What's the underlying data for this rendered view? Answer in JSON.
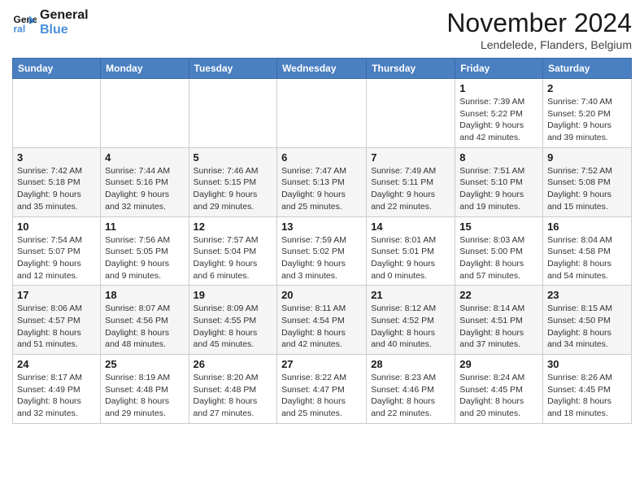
{
  "header": {
    "logo_line1": "General",
    "logo_line2": "Blue",
    "title": "November 2024",
    "location": "Lendelede, Flanders, Belgium"
  },
  "weekdays": [
    "Sunday",
    "Monday",
    "Tuesday",
    "Wednesday",
    "Thursday",
    "Friday",
    "Saturday"
  ],
  "weeks": [
    [
      {
        "day": "",
        "info": ""
      },
      {
        "day": "",
        "info": ""
      },
      {
        "day": "",
        "info": ""
      },
      {
        "day": "",
        "info": ""
      },
      {
        "day": "",
        "info": ""
      },
      {
        "day": "1",
        "info": "Sunrise: 7:39 AM\nSunset: 5:22 PM\nDaylight: 9 hours\nand 42 minutes."
      },
      {
        "day": "2",
        "info": "Sunrise: 7:40 AM\nSunset: 5:20 PM\nDaylight: 9 hours\nand 39 minutes."
      }
    ],
    [
      {
        "day": "3",
        "info": "Sunrise: 7:42 AM\nSunset: 5:18 PM\nDaylight: 9 hours\nand 35 minutes."
      },
      {
        "day": "4",
        "info": "Sunrise: 7:44 AM\nSunset: 5:16 PM\nDaylight: 9 hours\nand 32 minutes."
      },
      {
        "day": "5",
        "info": "Sunrise: 7:46 AM\nSunset: 5:15 PM\nDaylight: 9 hours\nand 29 minutes."
      },
      {
        "day": "6",
        "info": "Sunrise: 7:47 AM\nSunset: 5:13 PM\nDaylight: 9 hours\nand 25 minutes."
      },
      {
        "day": "7",
        "info": "Sunrise: 7:49 AM\nSunset: 5:11 PM\nDaylight: 9 hours\nand 22 minutes."
      },
      {
        "day": "8",
        "info": "Sunrise: 7:51 AM\nSunset: 5:10 PM\nDaylight: 9 hours\nand 19 minutes."
      },
      {
        "day": "9",
        "info": "Sunrise: 7:52 AM\nSunset: 5:08 PM\nDaylight: 9 hours\nand 15 minutes."
      }
    ],
    [
      {
        "day": "10",
        "info": "Sunrise: 7:54 AM\nSunset: 5:07 PM\nDaylight: 9 hours\nand 12 minutes."
      },
      {
        "day": "11",
        "info": "Sunrise: 7:56 AM\nSunset: 5:05 PM\nDaylight: 9 hours\nand 9 minutes."
      },
      {
        "day": "12",
        "info": "Sunrise: 7:57 AM\nSunset: 5:04 PM\nDaylight: 9 hours\nand 6 minutes."
      },
      {
        "day": "13",
        "info": "Sunrise: 7:59 AM\nSunset: 5:02 PM\nDaylight: 9 hours\nand 3 minutes."
      },
      {
        "day": "14",
        "info": "Sunrise: 8:01 AM\nSunset: 5:01 PM\nDaylight: 9 hours\nand 0 minutes."
      },
      {
        "day": "15",
        "info": "Sunrise: 8:03 AM\nSunset: 5:00 PM\nDaylight: 8 hours\nand 57 minutes."
      },
      {
        "day": "16",
        "info": "Sunrise: 8:04 AM\nSunset: 4:58 PM\nDaylight: 8 hours\nand 54 minutes."
      }
    ],
    [
      {
        "day": "17",
        "info": "Sunrise: 8:06 AM\nSunset: 4:57 PM\nDaylight: 8 hours\nand 51 minutes."
      },
      {
        "day": "18",
        "info": "Sunrise: 8:07 AM\nSunset: 4:56 PM\nDaylight: 8 hours\nand 48 minutes."
      },
      {
        "day": "19",
        "info": "Sunrise: 8:09 AM\nSunset: 4:55 PM\nDaylight: 8 hours\nand 45 minutes."
      },
      {
        "day": "20",
        "info": "Sunrise: 8:11 AM\nSunset: 4:54 PM\nDaylight: 8 hours\nand 42 minutes."
      },
      {
        "day": "21",
        "info": "Sunrise: 8:12 AM\nSunset: 4:52 PM\nDaylight: 8 hours\nand 40 minutes."
      },
      {
        "day": "22",
        "info": "Sunrise: 8:14 AM\nSunset: 4:51 PM\nDaylight: 8 hours\nand 37 minutes."
      },
      {
        "day": "23",
        "info": "Sunrise: 8:15 AM\nSunset: 4:50 PM\nDaylight: 8 hours\nand 34 minutes."
      }
    ],
    [
      {
        "day": "24",
        "info": "Sunrise: 8:17 AM\nSunset: 4:49 PM\nDaylight: 8 hours\nand 32 minutes."
      },
      {
        "day": "25",
        "info": "Sunrise: 8:19 AM\nSunset: 4:48 PM\nDaylight: 8 hours\nand 29 minutes."
      },
      {
        "day": "26",
        "info": "Sunrise: 8:20 AM\nSunset: 4:48 PM\nDaylight: 8 hours\nand 27 minutes."
      },
      {
        "day": "27",
        "info": "Sunrise: 8:22 AM\nSunset: 4:47 PM\nDaylight: 8 hours\nand 25 minutes."
      },
      {
        "day": "28",
        "info": "Sunrise: 8:23 AM\nSunset: 4:46 PM\nDaylight: 8 hours\nand 22 minutes."
      },
      {
        "day": "29",
        "info": "Sunrise: 8:24 AM\nSunset: 4:45 PM\nDaylight: 8 hours\nand 20 minutes."
      },
      {
        "day": "30",
        "info": "Sunrise: 8:26 AM\nSunset: 4:45 PM\nDaylight: 8 hours\nand 18 minutes."
      }
    ]
  ]
}
